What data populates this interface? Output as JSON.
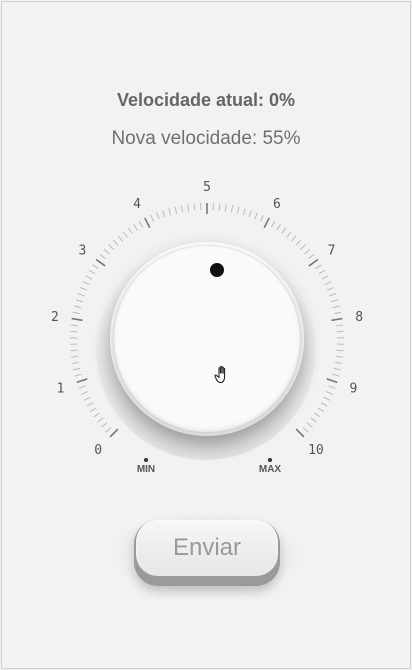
{
  "status": {
    "current_speed": "Velocidade atual: 0%",
    "new_speed": "Nova velocidade: 55%"
  },
  "dial": {
    "scale_labels": [
      "0",
      "1",
      "2",
      "3",
      "4",
      "5",
      "6",
      "7",
      "8",
      "9",
      "10"
    ],
    "min_label": "MIN",
    "max_label": "MAX",
    "value_percent": 55
  },
  "actions": {
    "send_label": "Enviar"
  },
  "colors": {
    "background": "#f2f2f2",
    "knob": "#fafafa",
    "indicator": "#111111",
    "text": "#666666"
  }
}
